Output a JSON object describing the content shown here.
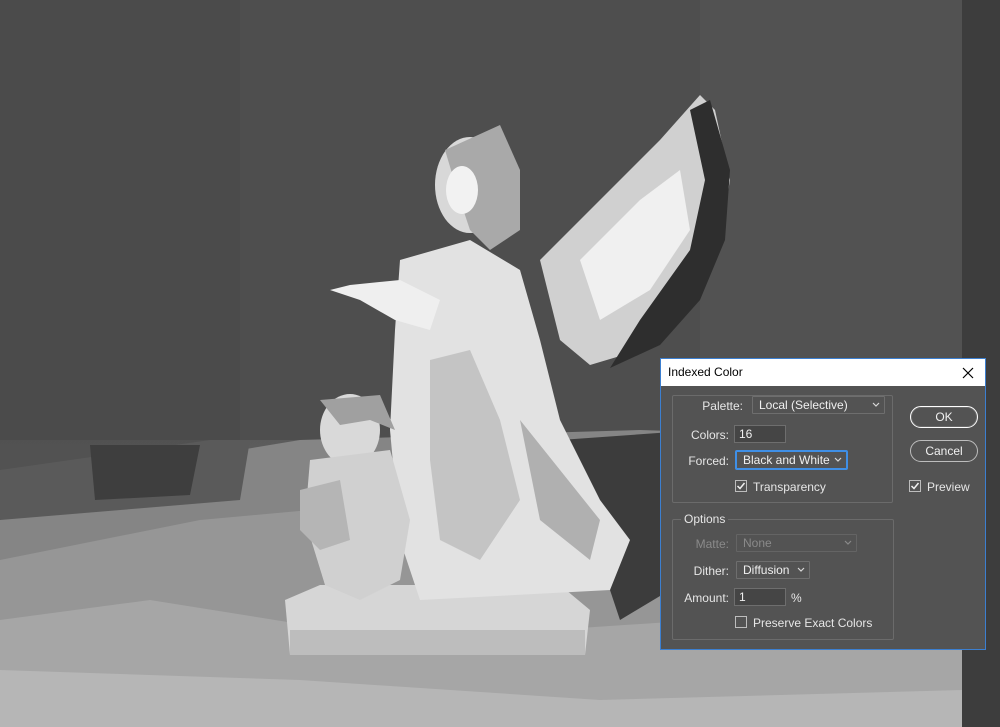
{
  "dialog": {
    "title": "Indexed Color",
    "palette_label": "Palette:",
    "palette_value": "Local (Selective)",
    "colors_label": "Colors:",
    "colors_value": "16",
    "forced_label": "Forced:",
    "forced_value": "Black and White",
    "transparency_label": "Transparency",
    "transparency_checked": true,
    "options_title": "Options",
    "matte_label": "Matte:",
    "matte_value": "None",
    "dither_label": "Dither:",
    "dither_value": "Diffusion",
    "amount_label": "Amount:",
    "amount_value": "1",
    "amount_unit": "%",
    "preserve_label": "Preserve Exact Colors",
    "preserve_checked": false,
    "ok_label": "OK",
    "cancel_label": "Cancel",
    "preview_label": "Preview",
    "preview_checked": true
  },
  "icons": {
    "close": "close-icon",
    "chevron": "chevron-down-icon",
    "check": "checkmark-icon"
  },
  "colors": {
    "dialog_bg": "#535353",
    "dialog_border": "#3c7fd0",
    "focus_ring": "#3f8fe6",
    "titlebar_bg": "#ffffff"
  }
}
